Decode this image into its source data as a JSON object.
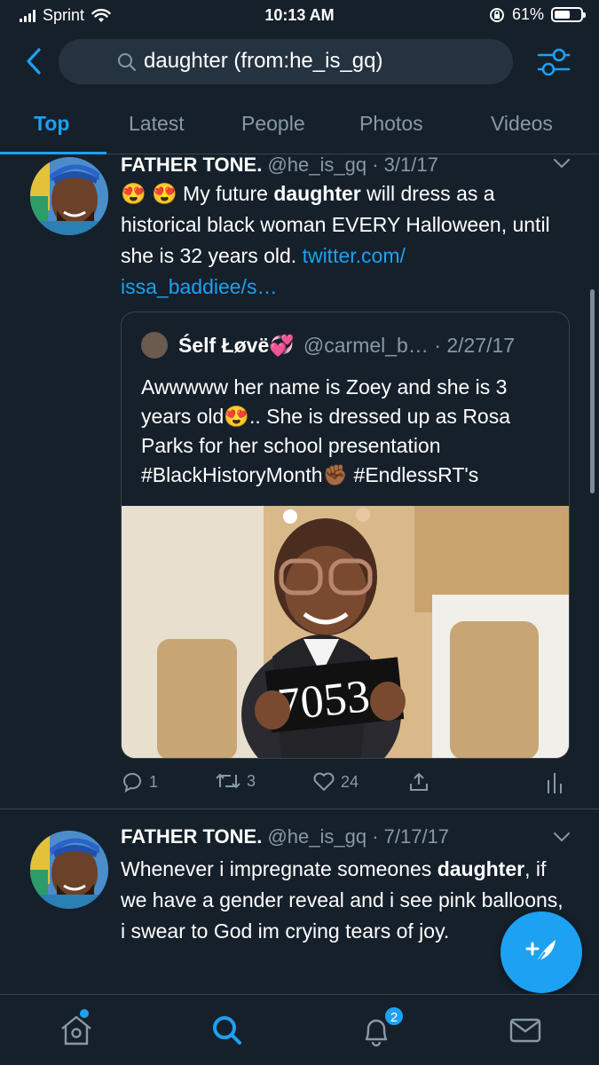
{
  "status_bar": {
    "carrier": "Sprint",
    "time": "10:13 AM",
    "battery": "61%",
    "battery_level": 0.61
  },
  "search": {
    "query": "daughter (from:he_is_gq)"
  },
  "tabs": [
    {
      "label": "Top",
      "active": true
    },
    {
      "label": "Latest",
      "active": false
    },
    {
      "label": "People",
      "active": false
    },
    {
      "label": "Photos",
      "active": false
    },
    {
      "label": "Videos",
      "active": false
    }
  ],
  "tweets": [
    {
      "author": "FATHER TONE.",
      "handle": "@he_is_gq",
      "date": "3/1/17",
      "text_emoji": "😍 😍",
      "text_1": " My future ",
      "text_bold": "daughter",
      "text_2": " will dress as a historical black woman EVERY Halloween, until she is 32 years old. ",
      "link": "twitter.com/ issa_baddiee/s…",
      "quote": {
        "author": "Śelf Łøvë💞",
        "handle": "@carmel_b…",
        "date": "2/27/17",
        "text": "Awwwww her name is Zoey and she is 3 years old😍.. She is dressed up as Rosa Parks for her school presentation #BlackHistoryMonth✊🏾 #EndlessRT's",
        "photo_sign": "7053"
      },
      "replies": "1",
      "retweets": "3",
      "likes": "24"
    },
    {
      "author": "FATHER TONE.",
      "handle": "@he_is_gq",
      "date": "7/17/17",
      "text_1": "Whenever i impregnate someones ",
      "text_bold": "daughter",
      "text_2": ", if we have a gender reveal and i see pink balloons, i swear to God im crying tears of joy."
    }
  ],
  "nav": {
    "notification_count": "2"
  },
  "colors": {
    "background": "#15202b",
    "accent": "#1da1f2",
    "muted": "#8899a6",
    "border": "#38444d"
  }
}
